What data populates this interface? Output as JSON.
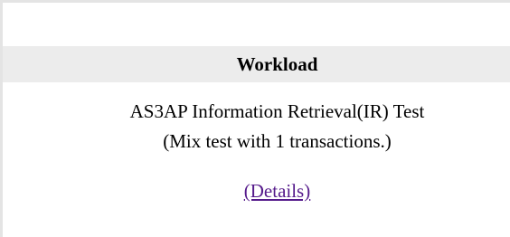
{
  "workload": {
    "heading": "Workload",
    "test_name": "AS3AP Information Retrieval(IR) Test",
    "test_mix": "(Mix test with 1 transactions.)",
    "details_link": "(Details)"
  },
  "colors": {
    "header_band": "#ececec",
    "frame_border": "#e4e4e4",
    "visited_link": "#551a8b"
  }
}
